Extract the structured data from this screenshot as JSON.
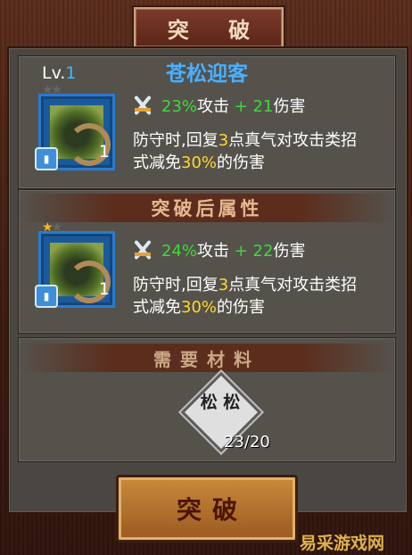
{
  "title": "突 破",
  "panel_current": {
    "level_prefix": "Lv.",
    "level_value": "1",
    "skill_name": "苍松迎客",
    "icon_count": "1",
    "stat": {
      "percent": "23%",
      "percent_label": "攻击",
      "plus": "+ 21",
      "plus_label": "伤害"
    },
    "desc_line1_a": "防守时,回复",
    "desc_line1_num": "3",
    "desc_line1_b": "点真气对攻击类招",
    "desc_line2_a": "式减免",
    "desc_line2_pct": "30%",
    "desc_line2_b": "的伤害"
  },
  "panel_after": {
    "header": "突破后属性",
    "icon_count": "1",
    "stat": {
      "percent": "24%",
      "percent_label": "攻击",
      "plus": "+ 22",
      "plus_label": "伤害"
    },
    "desc_line1_a": "防守时,回复",
    "desc_line1_num": "3",
    "desc_line1_b": "点真气对攻击类招",
    "desc_line2_a": "式减免",
    "desc_line2_pct": "30%",
    "desc_line2_b": "的伤害"
  },
  "materials": {
    "header": "需要材料",
    "item_text": "松 松",
    "count": "23/20"
  },
  "button": {
    "label": "突破"
  },
  "watermark": "易采游戏网",
  "colors": {
    "accent_blue": "#4ab0ff",
    "green": "#3fd93a",
    "yellow": "#ffd82b"
  }
}
